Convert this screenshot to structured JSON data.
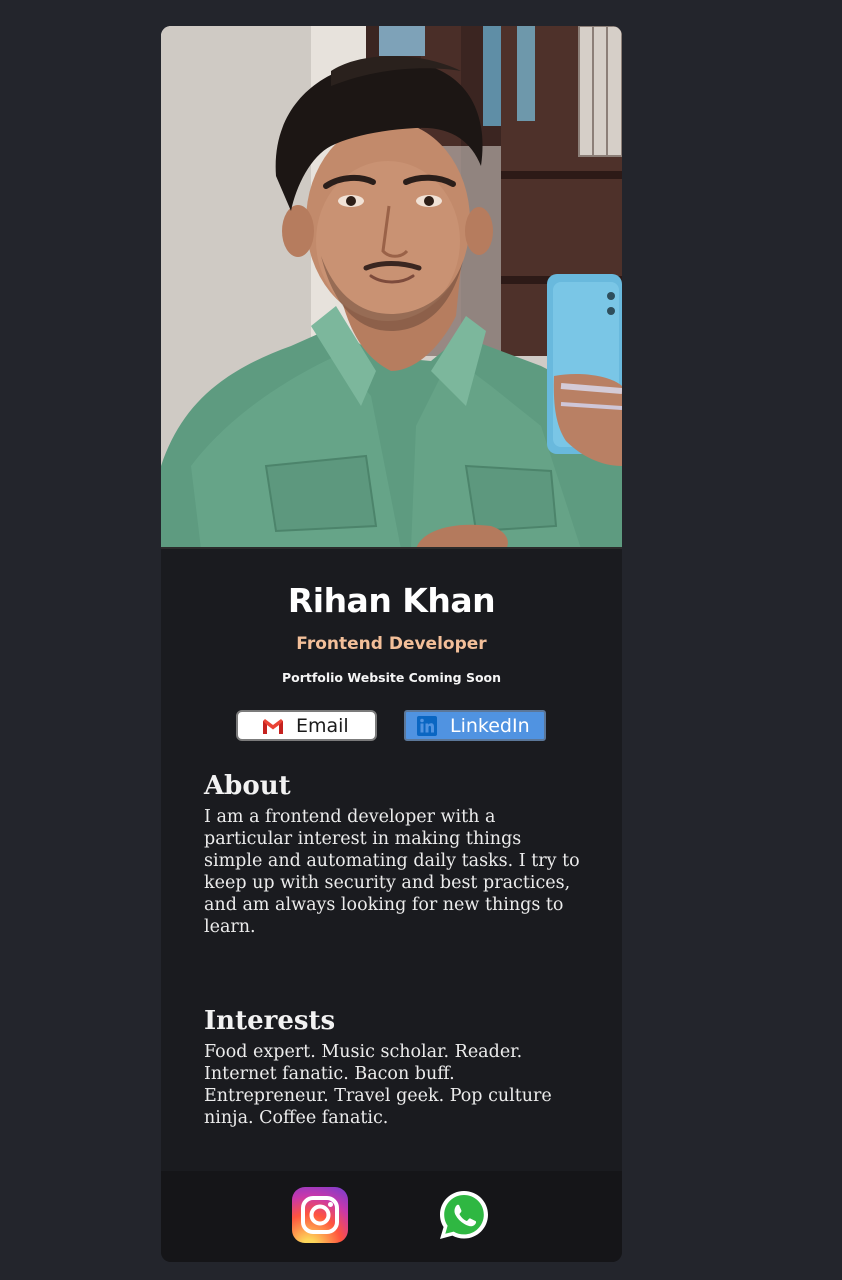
{
  "profile": {
    "name": "Rihan Khan",
    "role": "Frontend Developer",
    "tagline": "Portfolio Website Coming Soon",
    "photo_icon": "profile-photo"
  },
  "buttons": {
    "email": {
      "label": "Email",
      "icon": "gmail-icon"
    },
    "linkedin": {
      "label": "LinkedIn",
      "icon": "linkedin-icon"
    }
  },
  "about": {
    "title": "About",
    "body": "I am a frontend developer with a particular interest in making things simple and automating daily tasks. I try to keep up with security and best practices, and am always looking for new things to learn."
  },
  "interests": {
    "title": "Interests",
    "body": "Food expert. Music scholar. Reader. Internet fanatic. Bacon buff. Entrepreneur. Travel geek. Pop culture ninja. Coffee fanatic."
  },
  "footer": {
    "social": [
      {
        "icon": "instagram-icon"
      },
      {
        "icon": "whatsapp-icon"
      }
    ]
  },
  "colors": {
    "page_background": "#23252c",
    "card_background": "#1a1b1f",
    "footer_background": "#151518",
    "role_accent": "#f3bf99",
    "linkedin_blue": "#5093e1"
  }
}
